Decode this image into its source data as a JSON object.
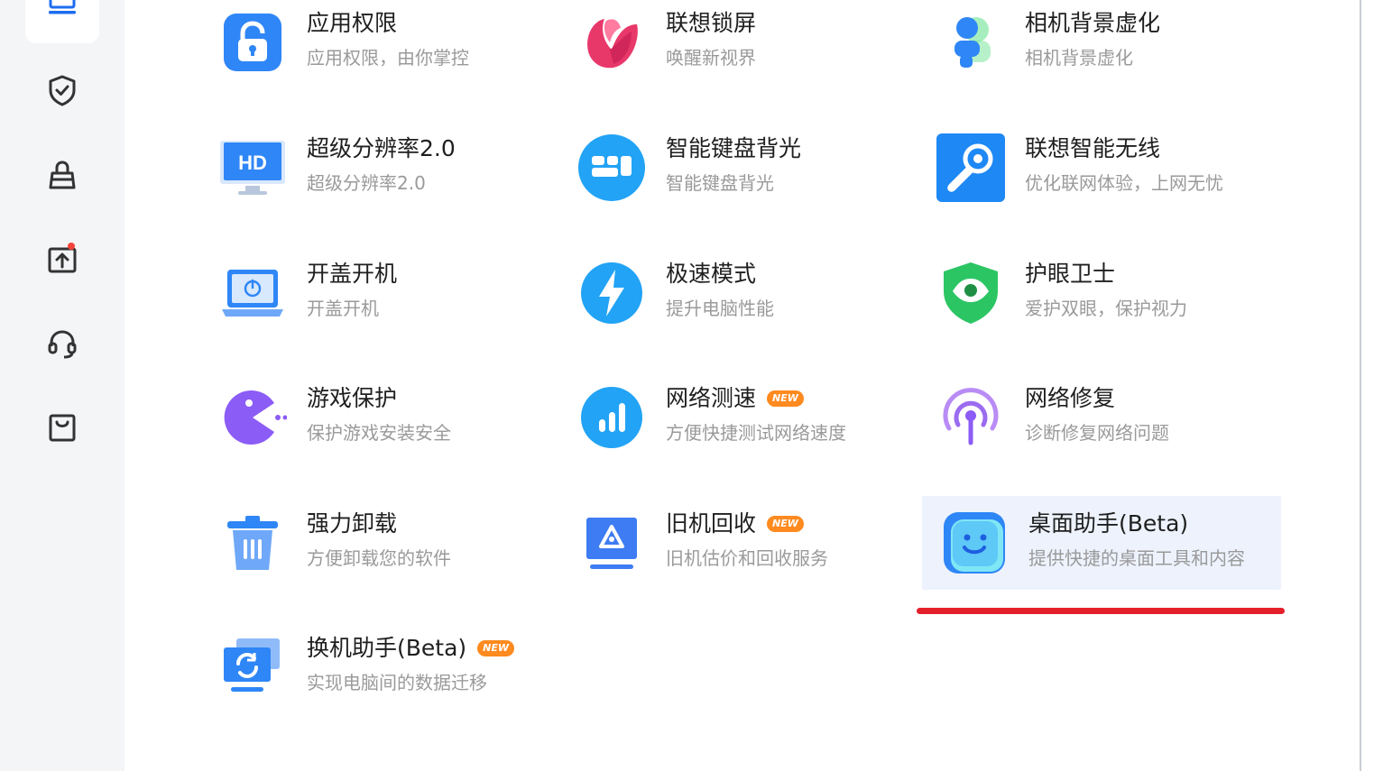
{
  "sidebar": {
    "items": [
      {
        "icon": "laptop-icon"
      },
      {
        "icon": "shield-check-icon"
      },
      {
        "icon": "bag-icon"
      },
      {
        "icon": "upload-notice-icon"
      },
      {
        "icon": "headset-icon"
      },
      {
        "icon": "shopping-bag-icon"
      }
    ]
  },
  "tiles": [
    {
      "id": "app-permission",
      "icon": "lock-icon",
      "title": "应用权限",
      "desc": "应用权限，由你掌控",
      "badge": ""
    },
    {
      "id": "lenovo-lockscreen",
      "icon": "lockscreen-logo-icon",
      "title": "联想锁屏",
      "desc": "唤醒新视界",
      "badge": ""
    },
    {
      "id": "camera-bg-blur",
      "icon": "person-blur-icon",
      "title": "相机背景虚化",
      "desc": "相机背景虚化",
      "badge": ""
    },
    {
      "id": "super-resolution",
      "icon": "hd-monitor-icon",
      "title": "超级分辨率2.0",
      "desc": "超级分辨率2.0",
      "badge": ""
    },
    {
      "id": "keyboard-backlight",
      "icon": "keyboard-icon",
      "title": "智能键盘背光",
      "desc": "智能键盘背光",
      "badge": ""
    },
    {
      "id": "smart-wireless",
      "icon": "wrench-icon",
      "title": "联想智能无线",
      "desc": "优化联网体验，上网无忧",
      "badge": ""
    },
    {
      "id": "lid-open-boot",
      "icon": "laptop-power-icon",
      "title": "开盖开机",
      "desc": "开盖开机",
      "badge": ""
    },
    {
      "id": "turbo-mode",
      "icon": "lightning-icon",
      "title": "极速模式",
      "desc": "提升电脑性能",
      "badge": ""
    },
    {
      "id": "eye-guard",
      "icon": "eye-shield-icon",
      "title": "护眼卫士",
      "desc": "爱护双眼，保护视力",
      "badge": ""
    },
    {
      "id": "game-protect",
      "icon": "pacman-icon",
      "title": "游戏保护",
      "desc": "保护游戏安装安全",
      "badge": ""
    },
    {
      "id": "speed-test",
      "icon": "bar-chart-icon",
      "title": "网络测速",
      "desc": "方便快捷测试网络速度",
      "badge": "NEW"
    },
    {
      "id": "network-repair",
      "icon": "signal-icon",
      "title": "网络修复",
      "desc": "诊断修复网络问题",
      "badge": ""
    },
    {
      "id": "force-uninstall",
      "icon": "trash-icon",
      "title": "强力卸载",
      "desc": "方便卸载您的软件",
      "badge": ""
    },
    {
      "id": "recycle",
      "icon": "recycle-icon",
      "title": "旧机回收",
      "desc": "旧机估价和回收服务",
      "badge": "NEW"
    },
    {
      "id": "desktop-assistant",
      "icon": "smile-face-icon",
      "title": "桌面助手(Beta)",
      "desc": "提供快捷的桌面工具和内容",
      "badge": "",
      "highlighted": true
    },
    {
      "id": "migration",
      "icon": "sync-monitor-icon",
      "title": "换机助手(Beta)",
      "desc": "实现电脑间的数据迁移",
      "badge": "NEW"
    }
  ],
  "colors": {
    "accent": "#1e88f5",
    "badge": "#ff8a1f",
    "highlight": "#edf2fd",
    "annotation": "#e4212b"
  }
}
